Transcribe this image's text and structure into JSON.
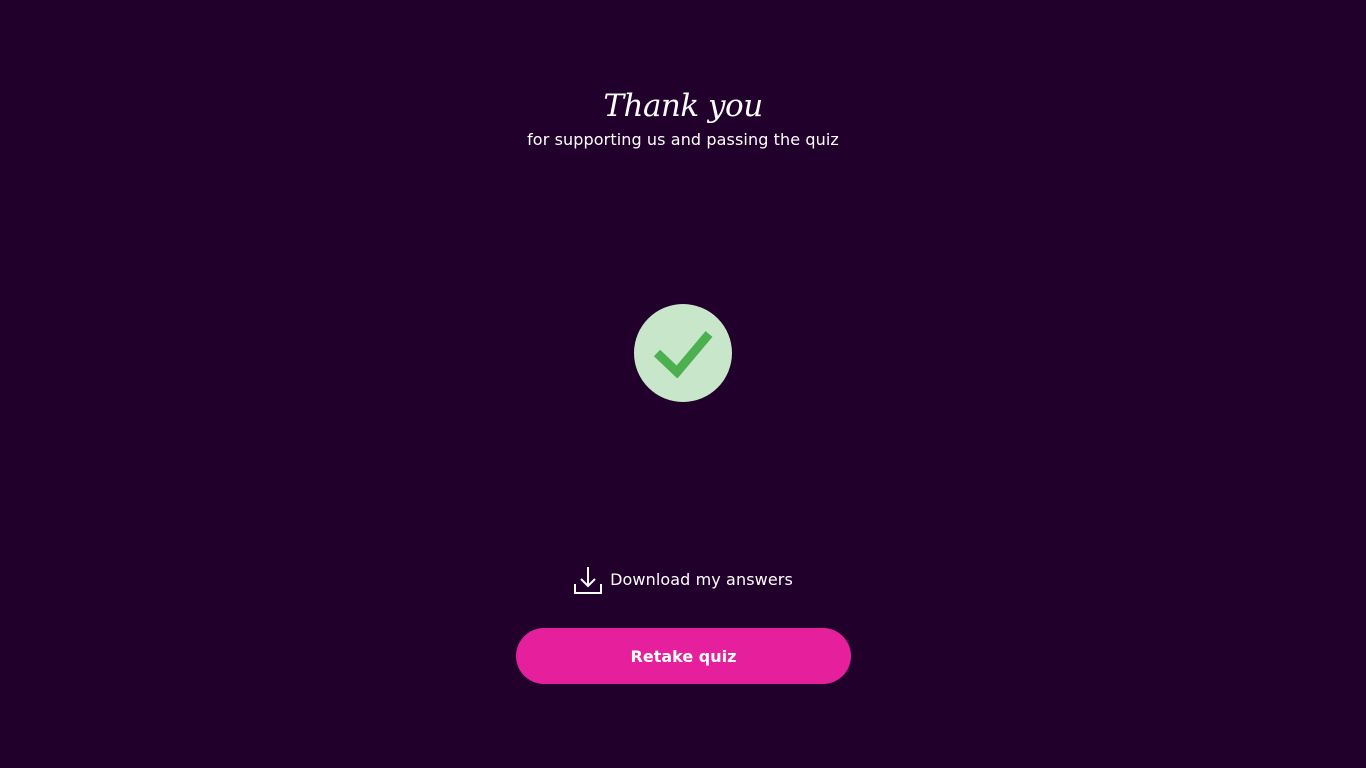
{
  "header": {
    "title": "Thank you",
    "subtitle": "for supporting us and passing the quiz"
  },
  "status": {
    "icon": "check-icon",
    "badge_color": "#c8e6c9",
    "check_color": "#4caf50"
  },
  "download": {
    "icon": "download-icon",
    "label": "Download my answers"
  },
  "actions": {
    "retake_label": "Retake quiz",
    "retake_color": "#e6209d"
  },
  "theme": {
    "background": "#21002c",
    "text": "#ffffff"
  }
}
